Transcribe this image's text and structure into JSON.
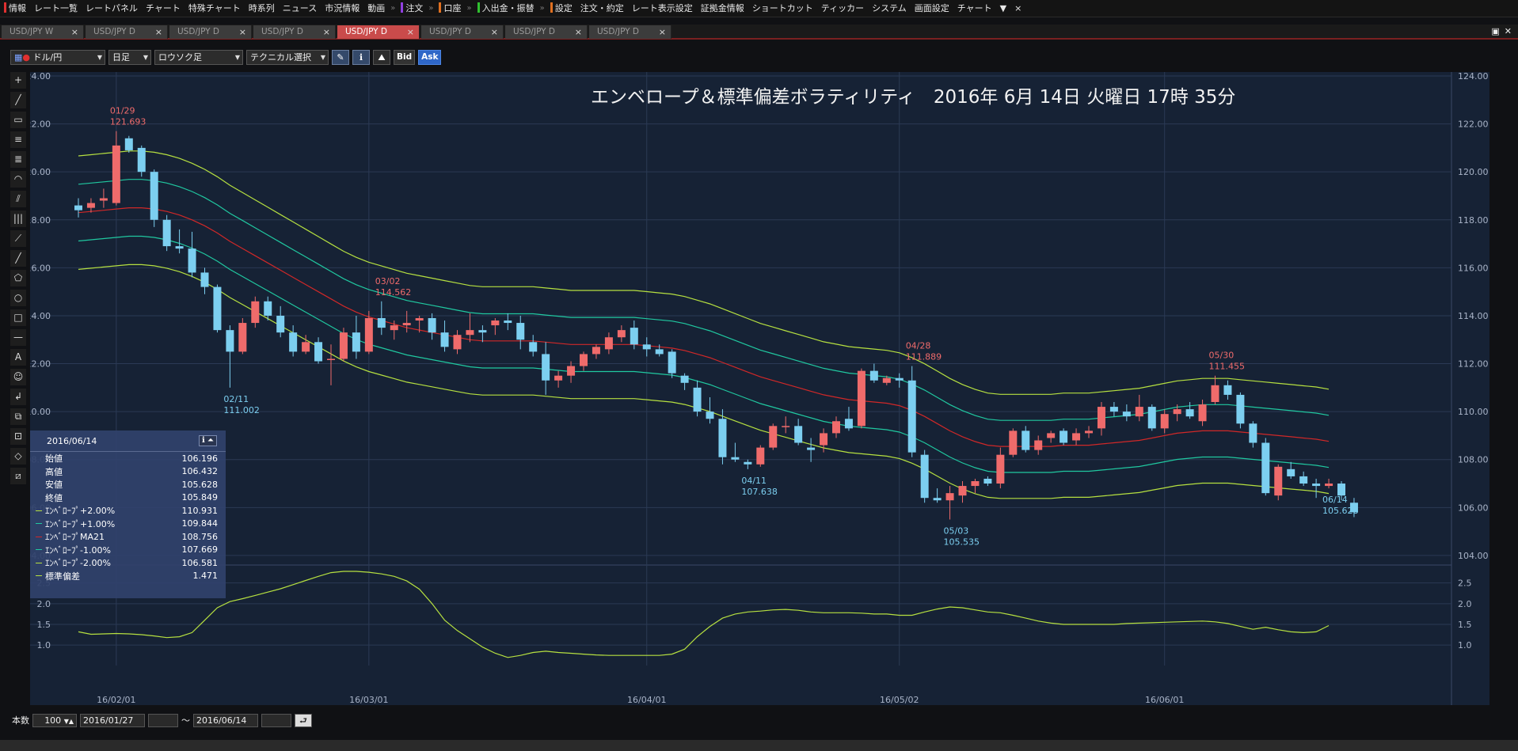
{
  "menu": [
    {
      "label": "情報",
      "mark": "#e03030"
    },
    {
      "label": "レート一覧"
    },
    {
      "label": "レートパネル"
    },
    {
      "label": "チャート"
    },
    {
      "label": "特殊チャート"
    },
    {
      "label": "時系列"
    },
    {
      "label": "ニュース"
    },
    {
      "label": "市況情報"
    },
    {
      "label": "動画"
    },
    {
      "label": "注文",
      "mark": "#9040e0",
      "sep": true
    },
    {
      "label": "口座",
      "mark": "#e07020",
      "sep": true
    },
    {
      "label": "入出金・振替",
      "mark": "#30c030",
      "sep": true
    },
    {
      "label": "設定",
      "mark": "#e07020",
      "sep": true
    },
    {
      "label": "注文・約定"
    },
    {
      "label": "レート表示設定"
    },
    {
      "label": "証拠金情報"
    },
    {
      "label": "ショートカット"
    },
    {
      "label": "ティッカー"
    },
    {
      "label": "システム"
    },
    {
      "label": "画面設定"
    },
    {
      "label": "チャート"
    },
    {
      "label": "▼"
    },
    {
      "label": "×"
    }
  ],
  "tabs": [
    {
      "label": "USD/JPY W"
    },
    {
      "label": "USD/JPY D"
    },
    {
      "label": "USD/JPY D"
    },
    {
      "label": "USD/JPY D"
    },
    {
      "label": "USD/JPY D",
      "active": true
    },
    {
      "label": "USD/JPY D"
    },
    {
      "label": "USD/JPY D"
    },
    {
      "label": "USD/JPY D"
    }
  ],
  "window_controls": {
    "restore": "▣",
    "close": "✕"
  },
  "toolbar": {
    "symbol": "ドル/円",
    "period": "日足",
    "chart_type": "ロウソク足",
    "technical": "テクニカル選択",
    "bid": "Bid",
    "ask": "Ask"
  },
  "tools": [
    "+",
    "╱",
    "▭",
    "≡",
    "≣",
    "◠",
    "⫽",
    "|||",
    "⟋",
    "╱",
    "⬠",
    "○",
    "□",
    "—",
    "A",
    "☺",
    "↲",
    "⧉",
    "⊡",
    "◇",
    "⧄"
  ],
  "info": {
    "date": "2016/06/14",
    "icons": "ℹ ⏶",
    "rows": [
      {
        "label": "始値",
        "value": "106.196"
      },
      {
        "label": "高値",
        "value": "106.432"
      },
      {
        "label": "安値",
        "value": "105.628"
      },
      {
        "label": "終値",
        "value": "105.849"
      },
      {
        "label": "ｴﾝﾍﾞﾛｰﾌﾟ+2.00%",
        "value": "110.931",
        "color": "#b6e040"
      },
      {
        "label": "ｴﾝﾍﾞﾛｰﾌﾟ+1.00%",
        "value": "109.844",
        "color": "#20c8a0"
      },
      {
        "label": "ｴﾝﾍﾞﾛｰﾌﾟMA21",
        "value": "108.756",
        "color": "#d02828"
      },
      {
        "label": "ｴﾝﾍﾞﾛｰﾌﾟ-1.00%",
        "value": "107.669",
        "color": "#20c8a0"
      },
      {
        "label": "ｴﾝﾍﾞﾛｰﾌﾟ-2.00%",
        "value": "106.581",
        "color": "#b6e040"
      },
      {
        "label": "標準偏差",
        "value": "1.471",
        "color": "#b6e040"
      }
    ]
  },
  "bottom": {
    "count_label": "本数",
    "count": "100",
    "start": "2016/01/27",
    "tilde": "〜",
    "end": "2016/06/14"
  },
  "chart_data": {
    "type": "candlestick",
    "title": "エンベロープ＆標準偏差ボラティリティ　2016年 6月 14日 火曜日 17時 35分",
    "colors": {
      "up": "#ef6b6b",
      "down": "#7ccff0",
      "bg": "#162235",
      "grid": "#2b3a55",
      "axis": "#a9b4c8"
    },
    "y_ticks": [
      "124.00",
      "122.00",
      "120.00",
      "118.00",
      "116.00",
      "114.00",
      "112.00",
      "110.00",
      "108.00",
      "106.00",
      "104.00"
    ],
    "ylim": [
      103.7,
      124.0
    ],
    "sd_ticks": [
      "2.5",
      "2.0",
      "1.5",
      "1.0"
    ],
    "sd_ylim": [
      0.6,
      2.8
    ],
    "x_ticks": [
      {
        "label": "16/02/01",
        "i": 3
      },
      {
        "label": "16/03/01",
        "i": 23
      },
      {
        "label": "16/04/01",
        "i": 45
      },
      {
        "label": "16/05/02",
        "i": 65
      },
      {
        "label": "16/06/01",
        "i": 86
      }
    ],
    "candles": [
      [
        118.6,
        118.9,
        118.1,
        118.4
      ],
      [
        118.5,
        118.9,
        118.3,
        118.7
      ],
      [
        118.8,
        119.3,
        118.5,
        118.9
      ],
      [
        118.7,
        121.7,
        118.6,
        121.1
      ],
      [
        121.4,
        121.5,
        120.8,
        120.9
      ],
      [
        121.0,
        121.1,
        119.8,
        120.0
      ],
      [
        120.0,
        120.1,
        117.7,
        118.0
      ],
      [
        118.0,
        118.2,
        116.7,
        116.9
      ],
      [
        116.9,
        117.6,
        116.6,
        116.8
      ],
      [
        116.8,
        117.5,
        115.6,
        115.8
      ],
      [
        115.8,
        116.0,
        114.9,
        115.2
      ],
      [
        115.2,
        115.3,
        113.3,
        113.4
      ],
      [
        113.4,
        113.6,
        111.0,
        112.5
      ],
      [
        112.5,
        113.9,
        112.4,
        113.7
      ],
      [
        113.7,
        114.8,
        113.5,
        114.6
      ],
      [
        114.6,
        114.8,
        113.8,
        114.0
      ],
      [
        114.0,
        114.4,
        113.1,
        113.3
      ],
      [
        113.3,
        113.6,
        112.3,
        112.5
      ],
      [
        112.5,
        113.2,
        112.4,
        112.9
      ],
      [
        112.9,
        113.1,
        112.0,
        112.1
      ],
      [
        112.2,
        112.8,
        111.1,
        112.2
      ],
      [
        112.2,
        113.5,
        112.1,
        113.3
      ],
      [
        113.3,
        114.0,
        112.2,
        112.5
      ],
      [
        112.5,
        114.2,
        112.4,
        113.9
      ],
      [
        113.9,
        114.6,
        113.2,
        113.5
      ],
      [
        113.4,
        113.8,
        113.0,
        113.6
      ],
      [
        113.6,
        114.2,
        113.3,
        113.7
      ],
      [
        113.8,
        114.0,
        113.3,
        113.9
      ],
      [
        113.9,
        114.1,
        113.0,
        113.3
      ],
      [
        113.3,
        113.8,
        112.5,
        112.7
      ],
      [
        112.6,
        113.4,
        112.4,
        113.2
      ],
      [
        113.2,
        114.1,
        112.9,
        113.4
      ],
      [
        113.4,
        113.6,
        112.9,
        113.3
      ],
      [
        113.6,
        113.9,
        113.2,
        113.8
      ],
      [
        113.8,
        114.1,
        113.4,
        113.7
      ],
      [
        113.7,
        114.0,
        112.6,
        113.0
      ],
      [
        112.9,
        113.2,
        112.3,
        112.5
      ],
      [
        112.4,
        112.9,
        110.7,
        111.3
      ],
      [
        111.3,
        111.7,
        111.0,
        111.5
      ],
      [
        111.5,
        112.1,
        111.2,
        111.9
      ],
      [
        111.9,
        112.5,
        111.7,
        112.4
      ],
      [
        112.4,
        112.8,
        112.2,
        112.7
      ],
      [
        112.6,
        113.3,
        112.4,
        113.1
      ],
      [
        113.1,
        113.6,
        112.9,
        113.4
      ],
      [
        113.5,
        113.8,
        112.6,
        112.8
      ],
      [
        112.8,
        113.1,
        112.3,
        112.6
      ],
      [
        112.6,
        112.8,
        112.3,
        112.4
      ],
      [
        112.5,
        112.6,
        111.4,
        111.6
      ],
      [
        111.5,
        111.6,
        110.9,
        111.2
      ],
      [
        111.0,
        111.3,
        109.8,
        110.0
      ],
      [
        110.0,
        110.6,
        109.5,
        109.7
      ],
      [
        109.7,
        110.1,
        107.8,
        108.1
      ],
      [
        108.1,
        108.7,
        107.9,
        108.0
      ],
      [
        107.9,
        108.0,
        107.6,
        107.8
      ],
      [
        107.8,
        108.6,
        107.7,
        108.5
      ],
      [
        108.5,
        109.5,
        108.4,
        109.4
      ],
      [
        109.4,
        109.8,
        109.1,
        109.4
      ],
      [
        109.4,
        109.7,
        108.6,
        108.7
      ],
      [
        108.5,
        108.9,
        107.9,
        108.4
      ],
      [
        108.6,
        109.3,
        108.3,
        109.1
      ],
      [
        109.1,
        109.8,
        108.9,
        109.6
      ],
      [
        109.7,
        110.2,
        109.2,
        109.3
      ],
      [
        109.4,
        111.8,
        109.3,
        111.7
      ],
      [
        111.7,
        112.0,
        111.2,
        111.3
      ],
      [
        111.2,
        111.5,
        111.1,
        111.4
      ],
      [
        111.4,
        111.6,
        111.0,
        111.3
      ],
      [
        111.3,
        111.9,
        108.1,
        108.3
      ],
      [
        108.2,
        108.4,
        106.2,
        106.4
      ],
      [
        106.4,
        106.8,
        106.2,
        106.3
      ],
      [
        106.3,
        106.9,
        105.5,
        106.6
      ],
      [
        106.5,
        107.1,
        106.2,
        106.9
      ],
      [
        106.9,
        107.2,
        106.6,
        107.1
      ],
      [
        107.2,
        107.3,
        106.9,
        107.0
      ],
      [
        107.0,
        108.5,
        106.8,
        108.2
      ],
      [
        108.2,
        109.3,
        108.1,
        109.2
      ],
      [
        109.2,
        109.4,
        108.3,
        108.4
      ],
      [
        108.4,
        109.0,
        108.2,
        108.8
      ],
      [
        108.9,
        109.2,
        108.7,
        109.1
      ],
      [
        109.2,
        109.3,
        108.6,
        108.7
      ],
      [
        108.8,
        109.3,
        108.6,
        109.1
      ],
      [
        109.1,
        109.4,
        108.9,
        109.2
      ],
      [
        109.3,
        110.4,
        109.0,
        110.2
      ],
      [
        110.2,
        110.4,
        109.8,
        110.0
      ],
      [
        110.0,
        110.3,
        109.6,
        109.8
      ],
      [
        109.8,
        110.7,
        109.6,
        110.2
      ],
      [
        110.2,
        110.3,
        109.2,
        109.3
      ],
      [
        109.3,
        110.1,
        109.1,
        109.9
      ],
      [
        109.9,
        110.3,
        109.6,
        110.1
      ],
      [
        110.1,
        110.4,
        109.7,
        109.8
      ],
      [
        109.6,
        110.5,
        109.4,
        110.3
      ],
      [
        110.4,
        111.5,
        110.3,
        111.1
      ],
      [
        111.1,
        111.3,
        110.5,
        110.7
      ],
      [
        110.7,
        110.8,
        109.3,
        109.5
      ],
      [
        109.5,
        109.6,
        108.5,
        108.7
      ],
      [
        108.7,
        108.9,
        106.5,
        106.6
      ],
      [
        106.5,
        107.8,
        106.3,
        107.7
      ],
      [
        107.6,
        107.9,
        107.2,
        107.3
      ],
      [
        107.3,
        107.5,
        106.9,
        107.0
      ],
      [
        107.0,
        107.2,
        106.4,
        106.9
      ],
      [
        106.9,
        107.2,
        106.8,
        107.0
      ],
      [
        107.0,
        107.1,
        106.3,
        106.5
      ],
      [
        106.2,
        106.4,
        105.6,
        105.8
      ]
    ],
    "ma21": [
      118.3,
      118.35,
      118.4,
      118.45,
      118.5,
      118.5,
      118.45,
      118.35,
      118.2,
      118.0,
      117.75,
      117.45,
      117.1,
      116.8,
      116.5,
      116.2,
      115.9,
      115.6,
      115.3,
      115.0,
      114.7,
      114.4,
      114.15,
      113.95,
      113.8,
      113.65,
      113.5,
      113.4,
      113.3,
      113.2,
      113.1,
      113.0,
      112.95,
      112.95,
      112.95,
      112.95,
      112.95,
      112.9,
      112.85,
      112.8,
      112.8,
      112.8,
      112.8,
      112.8,
      112.8,
      112.75,
      112.7,
      112.65,
      112.55,
      112.4,
      112.25,
      112.05,
      111.85,
      111.65,
      111.45,
      111.3,
      111.15,
      111.0,
      110.85,
      110.7,
      110.6,
      110.5,
      110.45,
      110.4,
      110.35,
      110.25,
      110.05,
      109.8,
      109.5,
      109.2,
      108.95,
      108.75,
      108.6,
      108.55,
      108.55,
      108.55,
      108.55,
      108.55,
      108.6,
      108.6,
      108.6,
      108.65,
      108.7,
      108.75,
      108.8,
      108.9,
      109.0,
      109.1,
      109.15,
      109.2,
      109.2,
      109.2,
      109.15,
      109.1,
      109.05,
      109.0,
      108.95,
      108.9,
      108.85,
      108.76
    ],
    "sd": [
      1.32,
      1.26,
      1.27,
      1.28,
      1.27,
      1.25,
      1.22,
      1.18,
      1.2,
      1.3,
      1.6,
      1.9,
      2.05,
      2.12,
      2.2,
      2.28,
      2.36,
      2.46,
      2.56,
      2.66,
      2.75,
      2.78,
      2.78,
      2.76,
      2.72,
      2.66,
      2.55,
      2.35,
      2.0,
      1.6,
      1.35,
      1.15,
      0.95,
      0.8,
      0.7,
      0.75,
      0.82,
      0.85,
      0.82,
      0.8,
      0.78,
      0.76,
      0.75,
      0.75,
      0.75,
      0.75,
      0.75,
      0.78,
      0.9,
      1.2,
      1.45,
      1.65,
      1.75,
      1.8,
      1.82,
      1.85,
      1.86,
      1.84,
      1.8,
      1.78,
      1.78,
      1.78,
      1.77,
      1.75,
      1.75,
      1.72,
      1.72,
      1.8,
      1.87,
      1.92,
      1.9,
      1.85,
      1.8,
      1.78,
      1.72,
      1.65,
      1.58,
      1.53,
      1.5,
      1.5,
      1.5,
      1.5,
      1.5,
      1.52,
      1.53,
      1.54,
      1.55,
      1.56,
      1.57,
      1.58,
      1.56,
      1.52,
      1.45,
      1.38,
      1.43,
      1.37,
      1.32,
      1.3,
      1.32,
      1.47
    ],
    "annotations": [
      {
        "i": 3,
        "date": "01/29",
        "value": "121.693",
        "pos": "above"
      },
      {
        "i": 12,
        "date": "02/11",
        "value": "111.002",
        "pos": "below"
      },
      {
        "i": 24,
        "date": "03/02",
        "value": "114.562",
        "pos": "above"
      },
      {
        "i": 53,
        "date": "04/11",
        "value": "107.638",
        "pos": "below"
      },
      {
        "i": 66,
        "date": "04/28",
        "value": "111.889",
        "pos": "above"
      },
      {
        "i": 69,
        "date": "05/03",
        "value": "105.535",
        "pos": "below"
      },
      {
        "i": 90,
        "date": "05/30",
        "value": "111.455",
        "pos": "above"
      },
      {
        "i": 99,
        "date": "06/14",
        "value": "105.628",
        "pos": "below"
      }
    ]
  }
}
